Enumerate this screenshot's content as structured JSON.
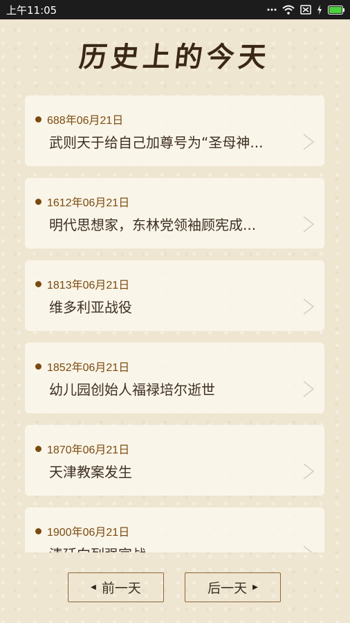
{
  "status_bar": {
    "time": "上午11:05",
    "icons": [
      "signal-dots-icon",
      "wifi-icon",
      "no-sim-icon",
      "charging-icon",
      "battery-icon"
    ]
  },
  "page": {
    "title": "历史上的今天"
  },
  "events": [
    {
      "date": "688年06月21日",
      "title": "武则天于给自己加尊号为“圣母神..."
    },
    {
      "date": "1612年06月21日",
      "title": "明代思想家，东林党领袖顾宪成..."
    },
    {
      "date": "1813年06月21日",
      "title": "维多利亚战役"
    },
    {
      "date": "1852年06月21日",
      "title": "幼儿园创始人福禄培尔逝世"
    },
    {
      "date": "1870年06月21日",
      "title": "天津教案发生"
    },
    {
      "date": "1900年06月21日",
      "title": "清廷向列强宣战"
    }
  ],
  "navigation": {
    "prev_label": "前一天",
    "next_label": "后一天"
  },
  "colors": {
    "background": "#efe6d2",
    "card": "#fcf8ee",
    "accent": "#7a4b10",
    "text": "#3d3022"
  }
}
